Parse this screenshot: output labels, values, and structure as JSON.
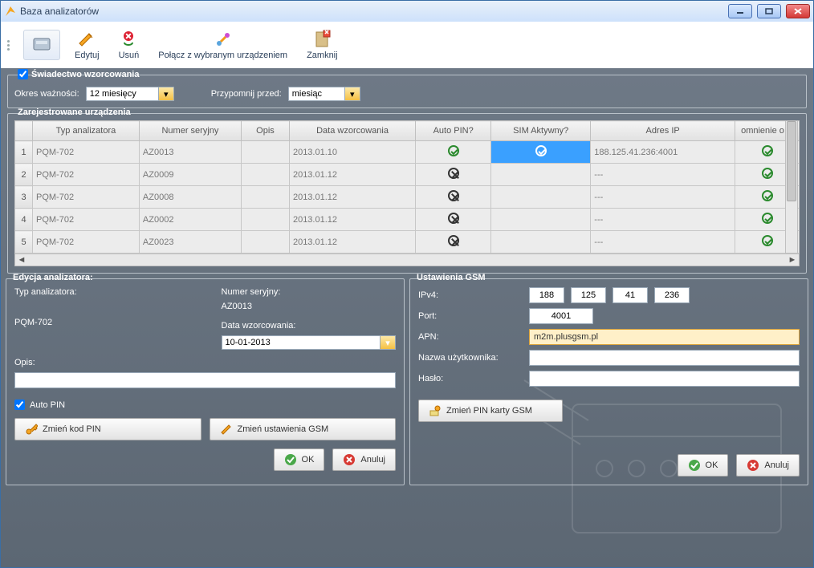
{
  "window": {
    "title": "Baza analizatorów"
  },
  "toolbar": {
    "edit": "Edytuj",
    "delete": "Usuń",
    "connect": "Połącz z wybranym urządzeniem",
    "close": "Zamknij"
  },
  "certificate": {
    "legend": "Świadectwo wzorcowania",
    "validity_label": "Okres ważności:",
    "validity_value": "12 miesięcy",
    "remind_label": "Przypomnij przed:",
    "remind_value": "miesiąc"
  },
  "devices": {
    "legend": "Zarejestrowane urządzenia",
    "columns": {
      "type": "Typ analizatora",
      "serial": "Numer seryjny",
      "desc": "Opis",
      "cal_date": "Data wzorcowania",
      "auto_pin": "Auto PIN?",
      "sim_active": "SIM Aktywny?",
      "ip": "Adres IP",
      "reminder": "omnienie o w"
    },
    "rows": [
      {
        "num": "1",
        "type": "PQM-702",
        "serial": "AZ0013",
        "desc": "",
        "cal_date": "2013.01.10",
        "auto_pin": "ok",
        "sim_active": "active",
        "ip": "188.125.41.236:4001",
        "reminder": "ok"
      },
      {
        "num": "2",
        "type": "PQM-702",
        "serial": "AZ0009",
        "desc": "",
        "cal_date": "2013.01.12",
        "auto_pin": "no",
        "sim_active": "",
        "ip": "---",
        "reminder": "ok"
      },
      {
        "num": "3",
        "type": "PQM-702",
        "serial": "AZ0008",
        "desc": "",
        "cal_date": "2013.01.12",
        "auto_pin": "no",
        "sim_active": "",
        "ip": "---",
        "reminder": "ok"
      },
      {
        "num": "4",
        "type": "PQM-702",
        "serial": "AZ0002",
        "desc": "",
        "cal_date": "2013.01.12",
        "auto_pin": "no",
        "sim_active": "",
        "ip": "---",
        "reminder": "ok"
      },
      {
        "num": "5",
        "type": "PQM-702",
        "serial": "AZ0023",
        "desc": "",
        "cal_date": "2013.01.12",
        "auto_pin": "no",
        "sim_active": "",
        "ip": "---",
        "reminder": "ok"
      }
    ]
  },
  "editor": {
    "legend": "Edycja analizatora:",
    "type_label": "Typ analizatora:",
    "type_value": "PQM-702",
    "serial_label": "Numer seryjny:",
    "serial_value": "AZ0013",
    "cal_date_label": "Data wzorcowania:",
    "cal_date_value": "10-01-2013",
    "desc_label": "Opis:",
    "desc_value": "",
    "auto_pin": "Auto PIN",
    "change_pin": "Zmień kod PIN",
    "change_gsm": "Zmień ustawienia GSM",
    "ok": "OK",
    "cancel": "Anuluj"
  },
  "gsm": {
    "legend": "Ustawienia GSM",
    "ipv4_label": "IPv4:",
    "ip": {
      "a": "188",
      "b": "125",
      "c": "41",
      "d": "236"
    },
    "port_label": "Port:",
    "port_value": "4001",
    "apn_label": "APN:",
    "apn_value": "m2m.plusgsm.pl",
    "user_label": "Nazwa użytkownika:",
    "user_value": "",
    "pass_label": "Hasło:",
    "pass_value": "",
    "change_sim_pin": "Zmień PIN karty GSM",
    "ok": "OK",
    "cancel": "Anuluj"
  }
}
